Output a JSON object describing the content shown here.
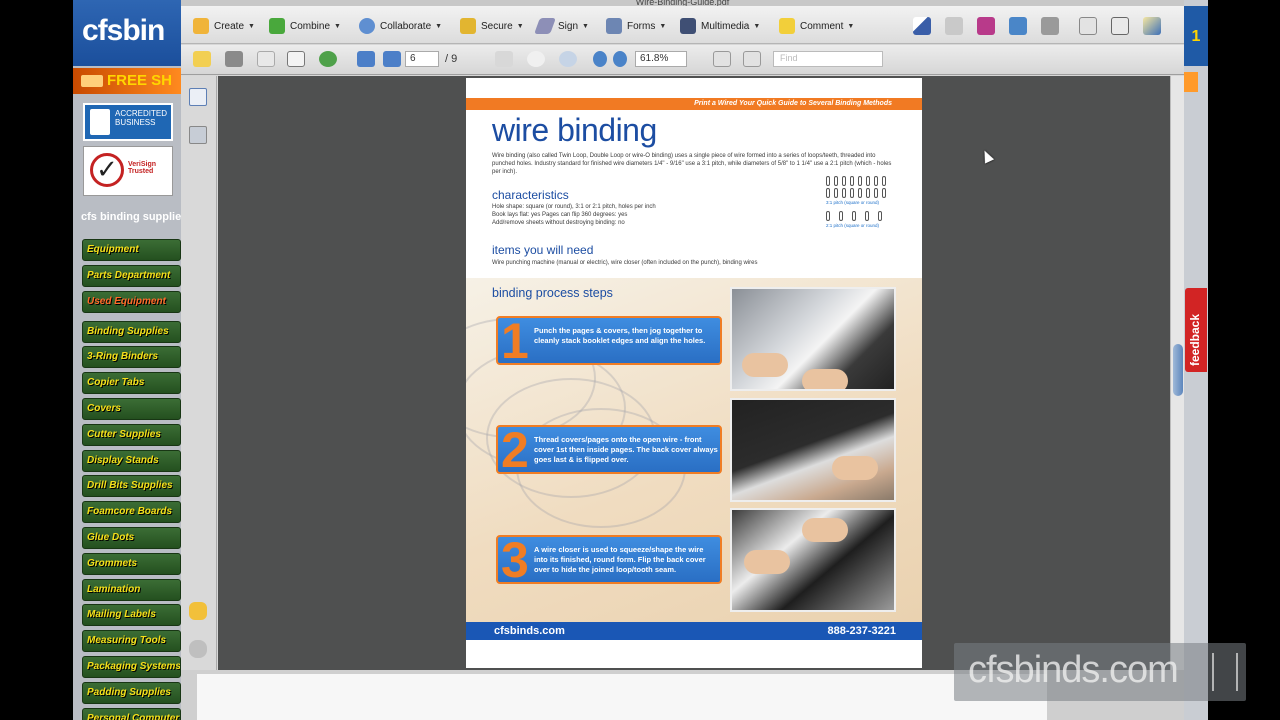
{
  "website": {
    "logo_text": "cfsbin",
    "free_banner": "FREE SH",
    "bbb_text": "ACCREDITED BUSINESS",
    "verisign_text": "VeriSign Trusted",
    "tagline": "cfs binding supplies",
    "menu": [
      "Equipment",
      "Parts Department",
      "Used Equipment",
      "Binding Supplies",
      "3-Ring Binders",
      "Copier Tabs",
      "Covers",
      "Cutter Supplies",
      "Display Stands",
      "Drill Bits Supplies",
      "Foamcore Boards",
      "Glue Dots",
      "Grommets",
      "Lamination",
      "Mailing Labels",
      "Measuring Tools",
      "Packaging Systems",
      "Padding Supplies",
      "Personal Computer"
    ]
  },
  "acrobat": {
    "title_strip": "Wire-Binding-Guide.pdf",
    "toolbar": {
      "create": "Create",
      "combine": "Combine",
      "collaborate": "Collaborate",
      "secure": "Secure",
      "sign": "Sign",
      "forms": "Forms",
      "multimedia": "Multimedia",
      "comment": "Comment"
    },
    "nav": {
      "page_current": "6",
      "page_total": "/ 9",
      "zoom": "61.8%",
      "find_placeholder": "Find"
    }
  },
  "pdf": {
    "top_banner": "Print a Wired Your Quick Guide to Several Binding Methods",
    "title": "wire binding",
    "intro": "Wire binding (also called Twin Loop, Double Loop or wire-O binding) uses a single piece of wire formed into a series of loops/teeth, threaded into punched holes. Industry standard for finished wire diameters 1/4\" - 9/16\" use a 3:1 pitch, while diameters of 5/8\" to 1 1/4\" use a 2:1 pitch (which - holes per inch).",
    "characteristics_heading": "characteristics",
    "characteristics_lines": [
      "Hole shape: square (or round), 3:1 or 2:1 pitch, holes per inch",
      "Book lays flat: yes    Pages can flip 360 degrees: yes",
      "Add/remove sheets without destroying binding: no"
    ],
    "diagram_labels": [
      "3:1 pitch (square or round)",
      "2:1 pitch (square or round)"
    ],
    "needs_heading": "items you will need",
    "needs_text": "Wire punching machine (manual or electric), wire closer (often included on the punch), binding wires",
    "steps_heading": "binding process steps",
    "steps": [
      {
        "num": "1",
        "text": "Punch the pages & covers, then jog together to cleanly stack booklet edges and align the holes."
      },
      {
        "num": "2",
        "text": "Thread covers/pages onto the open wire - front cover 1st then inside pages. The back cover always goes last & is flipped over."
      },
      {
        "num": "3",
        "text": "A wire closer is used to squeeze/shape the wire into its finished, round form. Flip the back cover over to hide the joined loop/tooth seam."
      }
    ],
    "footer_site": "cfsbinds.com",
    "footer_phone": "888-237-3221"
  },
  "feedback_label": "feedback",
  "watermark": "cfsbinds.com"
}
